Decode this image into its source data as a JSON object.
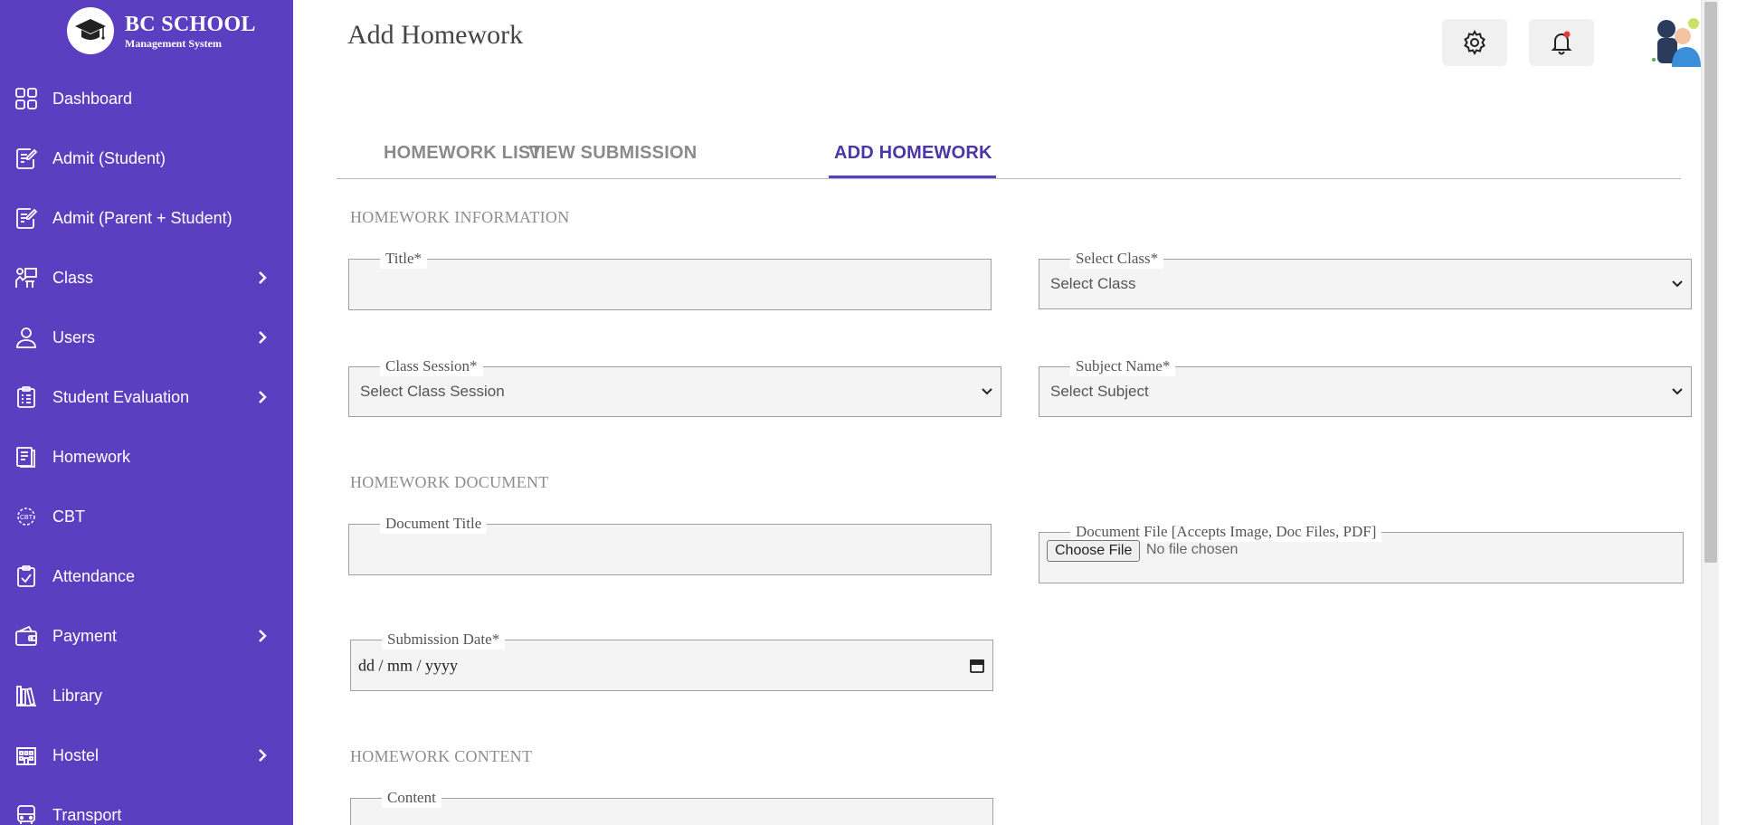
{
  "brand": {
    "title": "BC SCHOOL",
    "subtitle": "Management System"
  },
  "sidebar": {
    "items": [
      {
        "label": "Dashboard",
        "icon": "grid-icon",
        "has_submenu": false
      },
      {
        "label": "Admit (Student)",
        "icon": "edit-document-icon",
        "has_submenu": false
      },
      {
        "label": "Admit (Parent + Student)",
        "icon": "edit-document-icon",
        "has_submenu": false
      },
      {
        "label": "Class",
        "icon": "classroom-icon",
        "has_submenu": true
      },
      {
        "label": "Users",
        "icon": "user-icon",
        "has_submenu": true
      },
      {
        "label": "Student Evaluation",
        "icon": "clipboard-icon",
        "has_submenu": true
      },
      {
        "label": "Homework",
        "icon": "homework-icon",
        "has_submenu": false
      },
      {
        "label": "CBT",
        "icon": "cbt-icon",
        "has_submenu": false
      },
      {
        "label": "Attendance",
        "icon": "attendance-icon",
        "has_submenu": false
      },
      {
        "label": "Payment",
        "icon": "wallet-icon",
        "has_submenu": true
      },
      {
        "label": "Library",
        "icon": "library-icon",
        "has_submenu": false
      },
      {
        "label": "Hostel",
        "icon": "hostel-icon",
        "has_submenu": true
      },
      {
        "label": "Transport",
        "icon": "bus-icon",
        "has_submenu": false
      }
    ]
  },
  "header": {
    "page_title": "Add Homework"
  },
  "tabs": [
    {
      "label": "HOMEWORK LIST",
      "active": false
    },
    {
      "label": "VIEW SUBMISSION",
      "active": false
    },
    {
      "label": "ADD HOMEWORK",
      "active": true
    }
  ],
  "sections": {
    "info": "HOMEWORK INFORMATION",
    "document": "HOMEWORK DOCUMENT",
    "content": "HOMEWORK CONTENT"
  },
  "form": {
    "title": {
      "label": "Title*",
      "value": ""
    },
    "select_class": {
      "label": "Select Class*",
      "value": "Select Class"
    },
    "class_session": {
      "label": "Class Session*",
      "value": "Select Class Session"
    },
    "subject_name": {
      "label": "Subject Name*",
      "value": "Select Subject"
    },
    "document_title": {
      "label": "Document Title",
      "value": ""
    },
    "document_file": {
      "label": "Document File [Accepts Image, Doc Files, PDF]",
      "button": "Choose File",
      "status": "No file chosen"
    },
    "submission_date": {
      "label": "Submission Date*",
      "value": "dd / mm / yyyy"
    },
    "content": {
      "label": "Content"
    }
  },
  "colors": {
    "sidebar_bg": "#5b3fc0",
    "active_tab": "#4a36a8",
    "notification_dot": "#e53935"
  }
}
